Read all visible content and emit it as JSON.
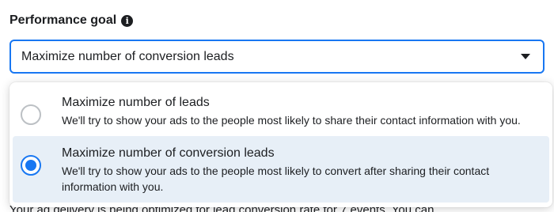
{
  "field": {
    "label": "Performance goal",
    "info_icon": "info-icon",
    "selected_value": "Maximize number of conversion leads"
  },
  "options": [
    {
      "title": "Maximize number of leads",
      "description": "We'll try to show your ads to the people most likely to share their contact information with you.",
      "selected": false
    },
    {
      "title": "Maximize number of conversion leads",
      "description": "We'll try to show your ads to the people most likely to convert after sharing their contact information with you.",
      "selected": true
    }
  ],
  "under_text": "Your ad delivery is being optimized for lead conversion rate for 7 events. You can",
  "colors": {
    "accent": "#1877f2",
    "selected_bg": "#e7eff7",
    "radio_border": "#bcc0c4"
  }
}
